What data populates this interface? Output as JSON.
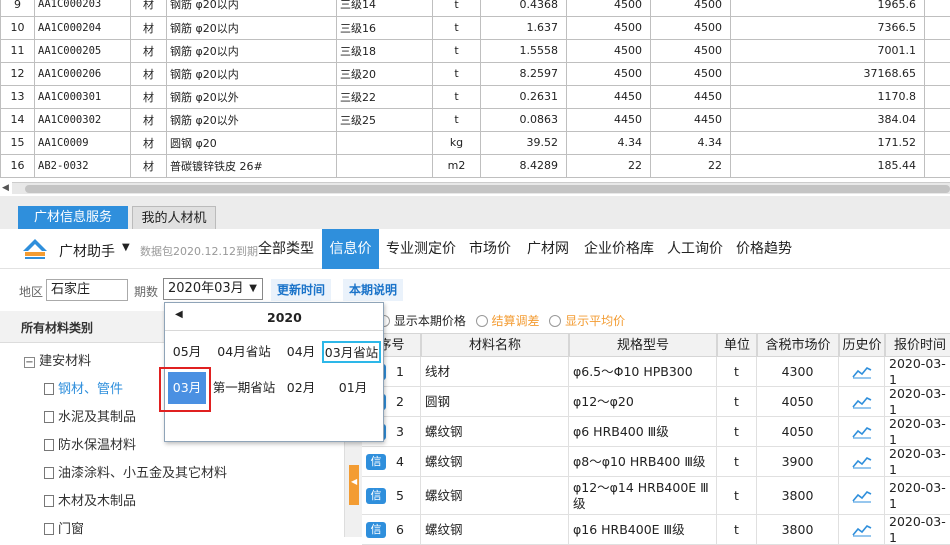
{
  "top_table": {
    "rows": [
      {
        "no": "9",
        "code": "AA1C000203",
        "type": "材",
        "name": "钢筋 φ20以内",
        "spec": "三级14",
        "unit": "t",
        "qty": "0.4368",
        "p1": "4500",
        "p2": "4500",
        "total": "1965.6"
      },
      {
        "no": "10",
        "code": "AA1C000204",
        "type": "材",
        "name": "钢筋 φ20以内",
        "spec": "三级16",
        "unit": "t",
        "qty": "1.637",
        "p1": "4500",
        "p2": "4500",
        "total": "7366.5"
      },
      {
        "no": "11",
        "code": "AA1C000205",
        "type": "材",
        "name": "钢筋 φ20以内",
        "spec": "三级18",
        "unit": "t",
        "qty": "1.5558",
        "p1": "4500",
        "p2": "4500",
        "total": "7001.1"
      },
      {
        "no": "12",
        "code": "AA1C000206",
        "type": "材",
        "name": "钢筋 φ20以内",
        "spec": "三级20",
        "unit": "t",
        "qty": "8.2597",
        "p1": "4500",
        "p2": "4500",
        "total": "37168.65"
      },
      {
        "no": "13",
        "code": "AA1C000301",
        "type": "材",
        "name": "钢筋 φ20以外",
        "spec": "三级22",
        "unit": "t",
        "qty": "0.2631",
        "p1": "4450",
        "p2": "4450",
        "total": "1170.8"
      },
      {
        "no": "14",
        "code": "AA1C000302",
        "type": "材",
        "name": "钢筋 φ20以外",
        "spec": "三级25",
        "unit": "t",
        "qty": "0.0863",
        "p1": "4450",
        "p2": "4450",
        "total": "384.04"
      },
      {
        "no": "15",
        "code": "AA1C0009",
        "type": "材",
        "name": "圆钢 φ20",
        "spec": "",
        "unit": "kg",
        "qty": "39.52",
        "p1": "4.34",
        "p2": "4.34",
        "total": "171.52"
      },
      {
        "no": "16",
        "code": "AB2-0032",
        "type": "材",
        "name": "普碳镀锌铁皮 26#",
        "spec": "",
        "unit": "m2",
        "qty": "8.4289",
        "p1": "22",
        "p2": "22",
        "total": "185.44"
      }
    ]
  },
  "tabs": {
    "service": "广材信息服务",
    "mine": "我的人材机"
  },
  "nav": {
    "brand": "广材助手",
    "data_pack": "数据包2020.12.12到期",
    "items": [
      "全部类型",
      "信息价",
      "专业测定价",
      "市场价",
      "广材网",
      "企业价格库",
      "人工询价",
      "价格趋势"
    ],
    "active": "信息价"
  },
  "filter": {
    "region_label": "地区",
    "region_value": "石家庄",
    "period_label": "期数",
    "period_value": "2020年03月",
    "update_time": "更新时间",
    "period_note": "本期说明"
  },
  "options": {
    "show_current": "显示本期价格",
    "settlement": "结算调差",
    "show_average": "显示平均价"
  },
  "sidebar": {
    "header": "所有材料类别",
    "root": "建安材料",
    "items": [
      "钢材、管件",
      "水泥及其制品",
      "防水保温材料",
      "油漆涂料、小五金及其它材料",
      "木材及木制品",
      "门窗"
    ]
  },
  "grid": {
    "headers": [
      "序号",
      "材料名称",
      "规格型号",
      "单位",
      "含税市场价",
      "历史价",
      "报价时间"
    ],
    "badge": "信",
    "rows": [
      {
        "no": "1",
        "name": "线材",
        "spec": "φ6.5～Φ10 HPB300",
        "unit": "t",
        "price": "4300",
        "date": "2020-03-1"
      },
      {
        "no": "2",
        "name": "圆钢",
        "spec": "φ12～φ20",
        "unit": "t",
        "price": "4050",
        "date": "2020-03-1"
      },
      {
        "no": "3",
        "name": "螺纹钢",
        "spec": "φ6 HRB400 Ⅲ级",
        "unit": "t",
        "price": "4050",
        "date": "2020-03-1"
      },
      {
        "no": "4",
        "name": "螺纹钢",
        "spec": "φ8～φ10 HRB400 Ⅲ级",
        "unit": "t",
        "price": "3900",
        "date": "2020-03-1"
      },
      {
        "no": "5",
        "name": "螺纹钢",
        "spec": "φ12～φ14 HRB400E Ⅲ级",
        "unit": "t",
        "price": "3800",
        "date": "2020-03-1"
      },
      {
        "no": "6",
        "name": "螺纹钢",
        "spec": "φ16 HRB400E Ⅲ级",
        "unit": "t",
        "price": "3800",
        "date": "2020-03-1"
      }
    ]
  },
  "calendar": {
    "year": "2020",
    "row1": [
      "05月",
      "04月省站",
      "04月",
      "03月省站"
    ],
    "row2": [
      "03月",
      "第一期省站",
      "02月",
      "01月"
    ],
    "colors": {
      "selected": "#4a90e2",
      "highlight_border": "#2db7e8",
      "red_frame": "#e02020"
    }
  }
}
